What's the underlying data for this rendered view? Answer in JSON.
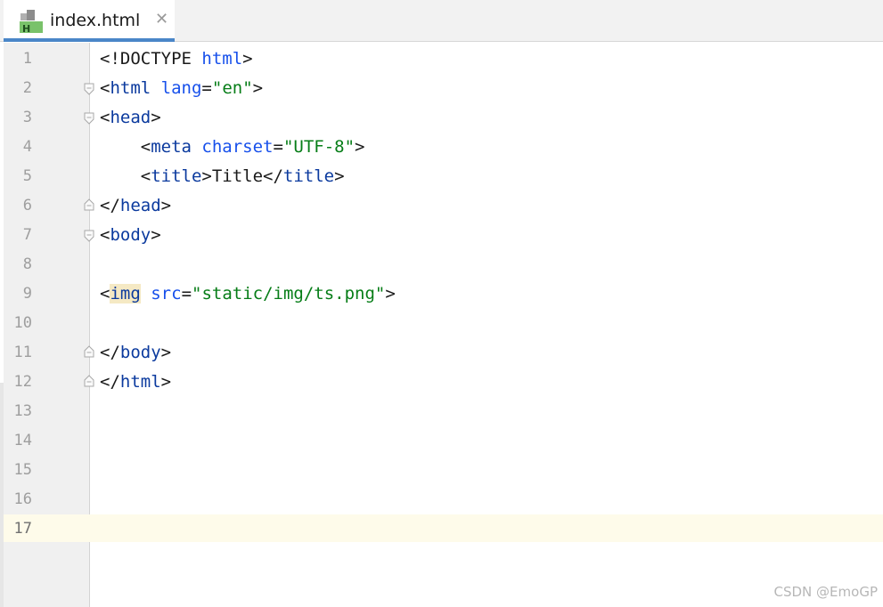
{
  "tab": {
    "label": "index.html",
    "close_glyph": "✕",
    "icon": "html-file-icon",
    "icon_letter": "H",
    "active_indicator_color": "#4a86c8"
  },
  "editor": {
    "current_line": "17",
    "line_numbers": [
      "1",
      "2",
      "3",
      "4",
      "5",
      "6",
      "7",
      "8",
      "9",
      "10",
      "11",
      "12",
      "13",
      "14",
      "15",
      "16",
      "17"
    ],
    "code": {
      "l1": {
        "a": "<!DOCTYPE ",
        "b": "html",
        "c": ">"
      },
      "l2": {
        "a": "<",
        "b": "html ",
        "c": "lang",
        "d": "=",
        "e": "\"en\"",
        "f": ">"
      },
      "l3": {
        "a": "<",
        "b": "head",
        "c": ">"
      },
      "l4": {
        "a": "    <",
        "b": "meta ",
        "c": "charset",
        "d": "=",
        "e": "\"UTF-8\"",
        "f": ">"
      },
      "l5": {
        "a": "    <",
        "b": "title",
        "c": ">Title</",
        "d": "title",
        "e": ">"
      },
      "l6": {
        "a": "</",
        "b": "head",
        "c": ">"
      },
      "l7": {
        "a": "<",
        "b": "body",
        "c": ">"
      },
      "l9": {
        "a": "<",
        "b": "img",
        "c": " ",
        "d": "src",
        "e": "=",
        "f": "\"static/img/ts.png\"",
        "g": ">"
      },
      "l11": {
        "a": "</",
        "b": "body",
        "c": ">"
      },
      "l12": {
        "a": "</",
        "b": "html",
        "c": ">"
      }
    },
    "colors": {
      "tag": "#0b3a9e",
      "attribute": "#1750eb",
      "string": "#067d17",
      "tag_highlight": "#f5e9c4",
      "current_line": "#fefbea"
    }
  },
  "watermark": "CSDN @EmoGP"
}
